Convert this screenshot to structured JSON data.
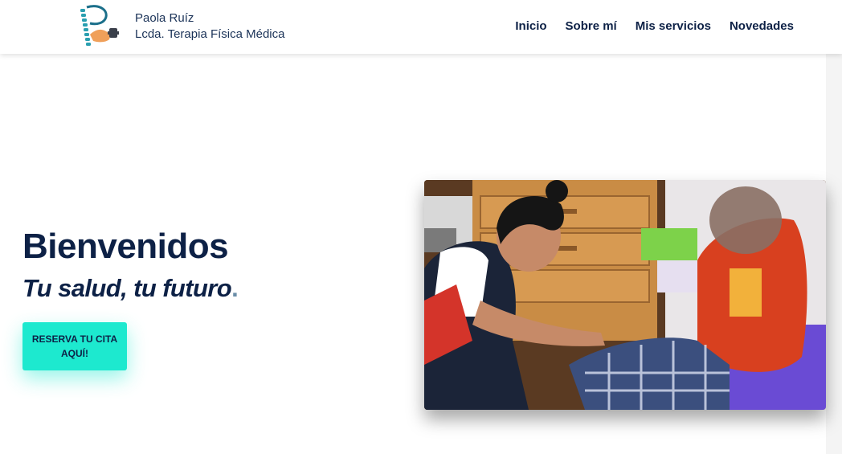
{
  "header": {
    "brand_name": "Paola Ruíz",
    "brand_title": "Lcda. Terapia Física Médica",
    "logo_icon": "spine-arm-logo",
    "nav": [
      {
        "label": "Inicio"
      },
      {
        "label": "Sobre mí"
      },
      {
        "label": "Mis servicios"
      },
      {
        "label": "Novedades"
      }
    ]
  },
  "hero": {
    "title": "Bienvenidos",
    "subtitle": "Tu salud, tu futuro",
    "subtitle_dot": ".",
    "cta_line1": "RESERVA TU CITA",
    "cta_line2": "AQUÍ!",
    "photo_icon": "therapy-session-photo"
  },
  "colors": {
    "navy": "#0d2146",
    "accent": "#1de9cf",
    "dot": "#6a8ea8"
  }
}
